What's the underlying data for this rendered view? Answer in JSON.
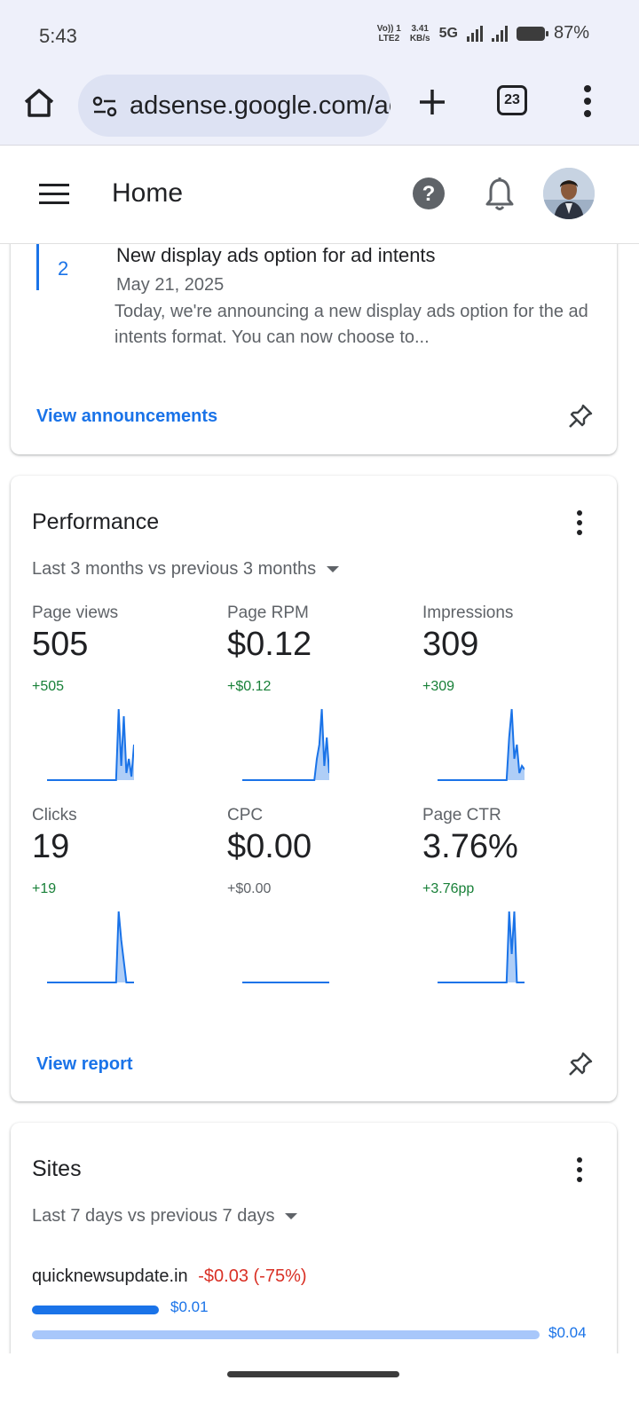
{
  "status_bar": {
    "time": "5:43",
    "volte": "Vo)) 1",
    "lte": "LTE2",
    "speed": "3.41",
    "speed_unit": "KB/s",
    "network": "5G",
    "battery": "87%"
  },
  "browser": {
    "url": "adsense.google.com/adsense",
    "tab_count": "23",
    "icons": [
      "home-icon",
      "site-settings-icon",
      "new-tab-icon",
      "tab-switcher-icon",
      "more-vert-icon"
    ]
  },
  "app_bar": {
    "title": "Home",
    "icons": [
      "menu-icon",
      "help-icon",
      "notifications-icon",
      "avatar"
    ]
  },
  "announcements": {
    "item": {
      "number": "2",
      "title": "New display ads option for ad intents",
      "date": "May 21, 2025",
      "body": "Today, we're announcing a new display ads option for the ad intents format. You can now choose to..."
    },
    "link": "View announcements"
  },
  "performance": {
    "title": "Performance",
    "range": "Last 3 months vs previous 3 months",
    "metrics": [
      {
        "label": "Page views",
        "value": "505",
        "delta": "+505",
        "delta_color": "#188038",
        "spark": [
          0,
          0,
          0,
          0,
          0,
          0,
          0,
          0,
          0,
          0,
          0,
          0,
          0,
          0,
          0,
          0,
          0,
          0,
          0,
          0,
          0,
          0,
          0,
          0,
          0,
          0,
          0,
          0,
          1.0,
          0.2,
          0.9,
          0.1,
          0.3,
          0.05,
          0.5
        ]
      },
      {
        "label": "Page RPM",
        "value": "$0.12",
        "delta": "+$0.12",
        "delta_color": "#188038",
        "spark": [
          0,
          0,
          0,
          0,
          0,
          0,
          0,
          0,
          0,
          0,
          0,
          0,
          0,
          0,
          0,
          0,
          0,
          0,
          0,
          0,
          0,
          0,
          0,
          0,
          0,
          0,
          0,
          0,
          0,
          0,
          0.3,
          0.5,
          1.0,
          0.2,
          0.6,
          0.1
        ]
      },
      {
        "label": "Impressions",
        "value": "309",
        "delta": "+309",
        "delta_color": "#188038",
        "spark": [
          0,
          0,
          0,
          0,
          0,
          0,
          0,
          0,
          0,
          0,
          0,
          0,
          0,
          0,
          0,
          0,
          0,
          0,
          0,
          0,
          0,
          0,
          0,
          0,
          0,
          0,
          0,
          0,
          0.6,
          1.0,
          0.3,
          0.5,
          0.1,
          0.2,
          0.15
        ]
      },
      {
        "label": "Clicks",
        "value": "19",
        "delta": "+19",
        "delta_color": "#188038",
        "spark": [
          0,
          0,
          0,
          0,
          0,
          0,
          0,
          0,
          0,
          0,
          0,
          0,
          0,
          0,
          0,
          0,
          0,
          0,
          0,
          0,
          0,
          0,
          0,
          0,
          0,
          0,
          0,
          0,
          1.0,
          0.6,
          0.3,
          0.0,
          0.0,
          0.0,
          0.0
        ]
      },
      {
        "label": "CPC",
        "value": "$0.00",
        "delta": "+$0.00",
        "delta_color": "#5f6368",
        "spark": [
          0,
          0,
          0,
          0,
          0,
          0,
          0,
          0,
          0,
          0,
          0,
          0,
          0,
          0,
          0,
          0,
          0,
          0,
          0,
          0,
          0,
          0,
          0,
          0,
          0,
          0,
          0,
          0,
          0,
          0,
          0,
          0,
          0,
          0,
          0
        ]
      },
      {
        "label": "Page CTR",
        "value": "3.76%",
        "delta": "+3.76pp",
        "delta_color": "#188038",
        "spark": [
          0,
          0,
          0,
          0,
          0,
          0,
          0,
          0,
          0,
          0,
          0,
          0,
          0,
          0,
          0,
          0,
          0,
          0,
          0,
          0,
          0,
          0,
          0,
          0,
          0,
          0,
          0,
          0,
          1.0,
          0.4,
          1.0,
          0.0,
          0.0,
          0.0,
          0.0
        ]
      }
    ],
    "link": "View report"
  },
  "sites": {
    "title": "Sites",
    "range": "Last 7 days vs previous 7 days",
    "site": "quicknewsupdate.in",
    "change": "-$0.03 (-75%)",
    "current": "$0.01",
    "previous": "$0.04",
    "current_fraction": 0.25
  },
  "colors": {
    "accent": "#1a73e8",
    "positive": "#188038",
    "negative": "#d93025",
    "light_bar": "#a8c7fa"
  }
}
